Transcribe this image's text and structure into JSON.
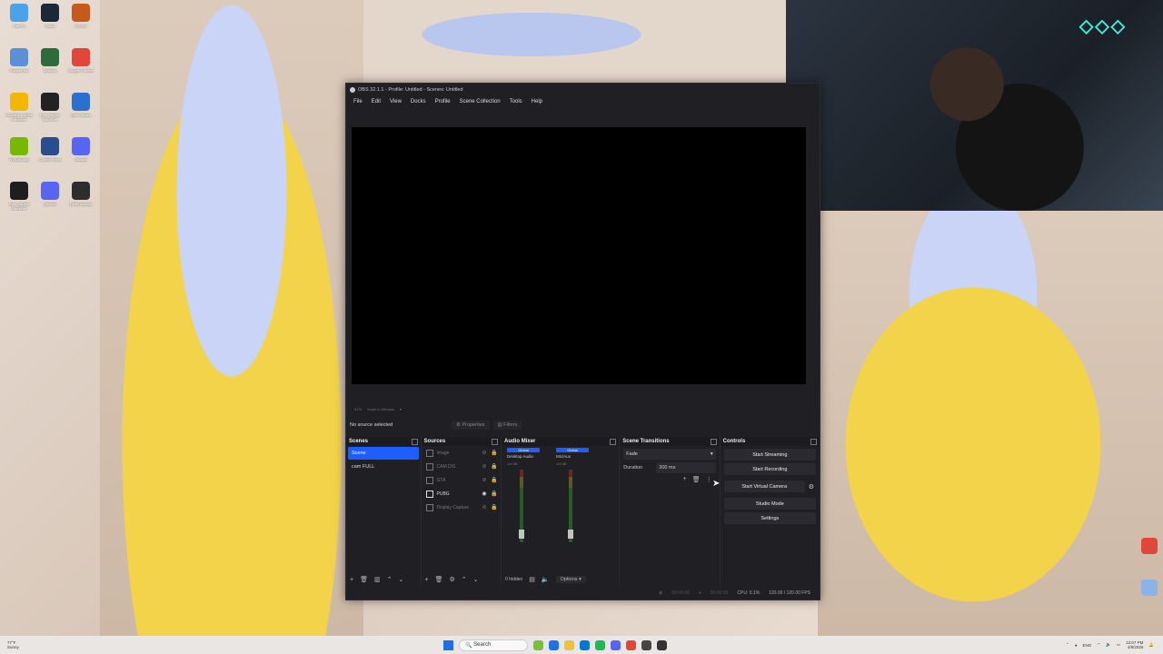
{
  "window": {
    "title": "OBS 32.1.1 - Profile: Untitled - Scenes: Untitled"
  },
  "menu": [
    "File",
    "Edit",
    "View",
    "Docks",
    "Profile",
    "Scene Collection",
    "Tools",
    "Help"
  ],
  "preview_strip": {
    "zoom": "51%",
    "scale": "Scale to Window"
  },
  "source_bar": {
    "status": "No source selected",
    "properties": "Properties",
    "filters": "Filters"
  },
  "scenes": {
    "title": "Scenes",
    "items": [
      {
        "name": "Scene",
        "active": true
      },
      {
        "name": "cam FULL",
        "active": false
      }
    ]
  },
  "sources": {
    "title": "Sources",
    "items": [
      {
        "name": "Image",
        "visible": false
      },
      {
        "name": "CAM DIS",
        "visible": false
      },
      {
        "name": "GTA",
        "visible": false
      },
      {
        "name": "PUBG",
        "visible": true
      },
      {
        "name": "Display Capture",
        "visible": false
      }
    ]
  },
  "audio_mixer": {
    "title": "Audio Mixer",
    "channels": [
      {
        "badge": "Global",
        "name": "Desktop Audio",
        "db": "-inf dB"
      },
      {
        "badge": "Global",
        "name": "Mic/Aux",
        "db": "-inf dB"
      }
    ],
    "hidden_label": "0 hidden",
    "options_label": "Options"
  },
  "transitions": {
    "title": "Scene Transitions",
    "selected": "Fade",
    "duration_label": "Duration",
    "duration_value": "300 ms"
  },
  "controls": {
    "title": "Controls",
    "start_streaming": "Start Streaming",
    "start_recording": "Start Recording",
    "start_virtual_camera": "Start Virtual Camera",
    "studio_mode": "Studio Mode",
    "settings": "Settings"
  },
  "status": {
    "stream_time": "00:00:00",
    "record_time": "00:00:00",
    "cpu": "CPU: 0.1%",
    "fps": "120.00 / 120.00 FPS"
  },
  "taskbar": {
    "weather_temp": "77°F",
    "weather_desc": "Sunny",
    "search": "Search",
    "lang": "ENG",
    "time": "12:07 PM",
    "date": "4/9/2026"
  },
  "desktop_icons": [
    {
      "label": "This PC",
      "color": "#4aa3e8"
    },
    {
      "label": "Steam",
      "color": "#1b2838"
    },
    {
      "label": "CS:GO",
      "color": "#c65a1e"
    },
    {
      "label": "Recycle Bin",
      "color": "#5b8fd6"
    },
    {
      "label": "Desktop",
      "color": "#2e6b3a"
    },
    {
      "label": "Google Chrome",
      "color": "#e0463a"
    },
    {
      "label": "Rockstar Games Launcher",
      "color": "#f2b705"
    },
    {
      "label": "Epic Games Launcher",
      "color": "#222222"
    },
    {
      "label": "Epic Games",
      "color": "#2b6fcf"
    },
    {
      "label": "NVIDIA App",
      "color": "#76b900"
    },
    {
      "label": "Control Panel",
      "color": "#2a4d8f"
    },
    {
      "label": "Discord",
      "color": "#5865f2"
    },
    {
      "label": "Epic Games Launcher",
      "color": "#1e1e1e"
    },
    {
      "label": "Discord",
      "color": "#5865f2"
    },
    {
      "label": "Dolby Access",
      "color": "#2d2d2d"
    }
  ]
}
